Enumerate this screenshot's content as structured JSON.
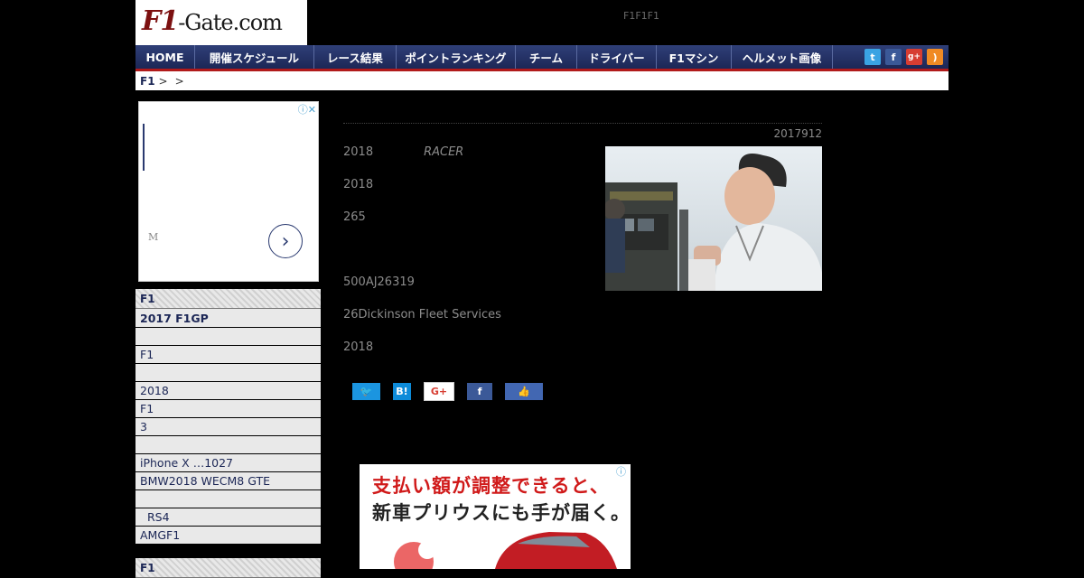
{
  "site": {
    "logo_main": "F1",
    "logo_rest": "-Gate.com",
    "header_note": "F1F1F1"
  },
  "nav": {
    "items": [
      {
        "label": "HOME"
      },
      {
        "label": "開催スケジュール"
      },
      {
        "label": "レース結果"
      },
      {
        "label": "ポイントランキング"
      },
      {
        "label": "チーム"
      },
      {
        "label": "ドライバー"
      },
      {
        "label": "F1マシン"
      },
      {
        "label": "ヘルメット画像"
      }
    ],
    "social": [
      {
        "icon": "twitter-icon",
        "glyph": "t",
        "color": "#3aa3e3"
      },
      {
        "icon": "facebook-icon",
        "glyph": "f",
        "color": "#3b5998"
      },
      {
        "icon": "google-plus-icon",
        "glyph": "g+",
        "color": "#d73d32"
      },
      {
        "icon": "rss-icon",
        "glyph": ")",
        "color": "#f08a24"
      }
    ]
  },
  "breadcrumb": {
    "home": "F1",
    "sep1": ">",
    "sep2": ">"
  },
  "ad": {
    "letter": "M",
    "arrow": "›",
    "adchoice": "ⓘ✕"
  },
  "sidebar": {
    "head1": "F1",
    "items": [
      {
        "label": "2017 F1GP",
        "bold": true
      },
      {
        "label": ""
      },
      {
        "label": "F1"
      },
      {
        "label": ""
      },
      {
        "label": "2018"
      },
      {
        "label": "F1"
      },
      {
        "label": "3"
      },
      {
        "label": ""
      },
      {
        "label": "iPhone X …1027"
      },
      {
        "label": "BMW2018 WECM8 GTE"
      },
      {
        "label": ""
      },
      {
        "label": "  RS4"
      },
      {
        "label": "AMGF1"
      }
    ],
    "head2": "F1"
  },
  "article": {
    "date": "2017912",
    "paragraphs": [
      {
        "text": "2018",
        "extra": "RACER"
      },
      {
        "text": "2018"
      },
      {
        "text": "265"
      },
      {
        "text": "500AJ26319"
      },
      {
        "text": "26Dickinson Fleet Services"
      },
      {
        "text": "2018"
      }
    ]
  },
  "share": {
    "twitter": "🐦",
    "hatena": "B!",
    "google": "G+",
    "facebook": "f",
    "like": "👍"
  },
  "banner": {
    "line1": "支払い額が調整できると、",
    "line2": "新車プリウスにも手が届く。"
  }
}
